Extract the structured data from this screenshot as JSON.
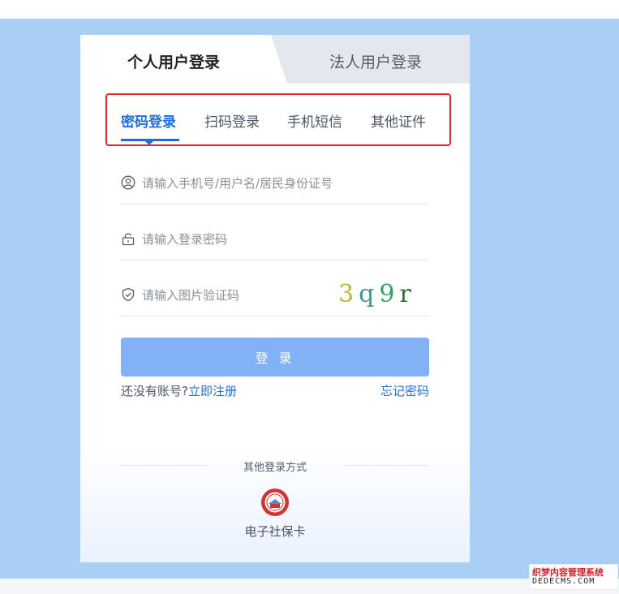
{
  "tabs": {
    "personal": "个人用户登录",
    "legal": "法人用户登录"
  },
  "subtabs": [
    "密码登录",
    "扫码登录",
    "手机短信",
    "其他证件"
  ],
  "form": {
    "account_placeholder": "请输入手机号/用户名/居民身份证号",
    "password_placeholder": "请输入登录密码",
    "captcha_placeholder": "请输入图片验证码",
    "captcha_chars": [
      "3",
      "q",
      "9",
      "r"
    ],
    "login_label": "登 录"
  },
  "links": {
    "no_account": "还没有账号?",
    "register": "立即注册",
    "forgot": "忘记密码"
  },
  "other_login": {
    "title": "其他登录方式",
    "sscard_label": "电子社保卡"
  },
  "icons": {
    "account": "user-circle-icon",
    "password": "lock-icon",
    "captcha": "shield-check-icon",
    "sscard": "social-security-card-icon"
  },
  "colors": {
    "accent": "#1e6fd9",
    "login_button": "#82b1f5",
    "page_background": "#a9cff5",
    "highlight_box": "#e7262b"
  },
  "watermark": {
    "line1": "织梦内容管理系统",
    "line2": "DEDECMS.COM"
  }
}
